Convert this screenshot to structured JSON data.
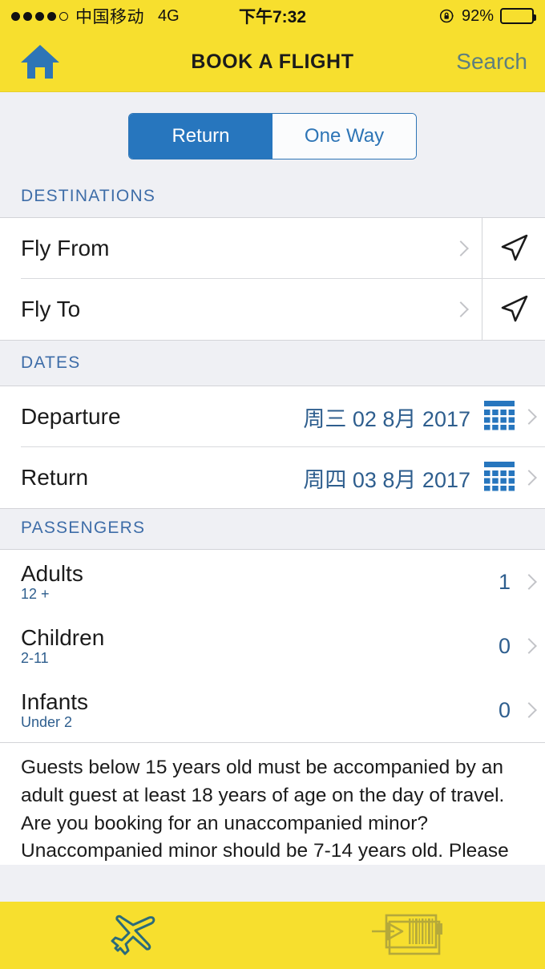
{
  "status_bar": {
    "signal_dots_filled": 4,
    "signal_dots_total": 5,
    "carrier": "中国移动",
    "network": "4G",
    "time": "下午7:32",
    "battery_percent": "92%",
    "battery_level": 92,
    "rotation_lock_icon": "rotation-lock-icon"
  },
  "nav": {
    "home_icon": "home-icon",
    "title": "BOOK A FLIGHT",
    "search_label": "Search",
    "search_color": "#5E7F7E"
  },
  "trip_type": {
    "options": [
      "Return",
      "One Way"
    ],
    "selected": "Return",
    "accent": "#2776BE"
  },
  "sections": {
    "destinations": {
      "header": "DESTINATIONS",
      "rows": [
        {
          "label": "Fly From",
          "icon": "navigation-arrow-icon",
          "chevron": "chevron-right-icon"
        },
        {
          "label": "Fly To",
          "icon": "navigation-arrow-icon",
          "chevron": "chevron-right-icon"
        }
      ]
    },
    "dates": {
      "header": "DATES",
      "rows": [
        {
          "label": "Departure",
          "value": "周三 02 8月 2017",
          "icon": "calendar-icon",
          "chevron": "chevron-right-icon"
        },
        {
          "label": "Return",
          "value": "周四 03 8月 2017",
          "icon": "calendar-icon",
          "chevron": "chevron-right-icon"
        }
      ]
    },
    "passengers": {
      "header": "PASSENGERS",
      "rows": [
        {
          "label": "Adults",
          "sub": "12 +",
          "value": "1",
          "chevron": "chevron-right-icon"
        },
        {
          "label": "Children",
          "sub": "2-11",
          "value": "0",
          "chevron": "chevron-right-icon"
        },
        {
          "label": "Infants",
          "sub": "Under 2",
          "value": "0",
          "chevron": "chevron-right-icon"
        }
      ]
    }
  },
  "disclaimer": "Guests below 15 years old must be accompanied by an adult guest at least 18 years of age on the day of travel. Are you booking for an unaccompanied minor? Unaccompanied minor should be 7-14 years old. Please",
  "tabbar": {
    "items": [
      {
        "icon": "airplane-icon",
        "active": true
      },
      {
        "icon": "boarding-pass-barcode-icon",
        "active": false
      }
    ],
    "background": "#F7DF2E",
    "active_color": "#2B6B7A",
    "inactive_color": "#B5A93A"
  },
  "colors": {
    "brand_yellow": "#F7DF2E",
    "blue": "#2776BE",
    "section_header_blue": "#3E6DA8",
    "value_blue": "#2E5E8E",
    "page_bg": "#EFF0F4"
  }
}
